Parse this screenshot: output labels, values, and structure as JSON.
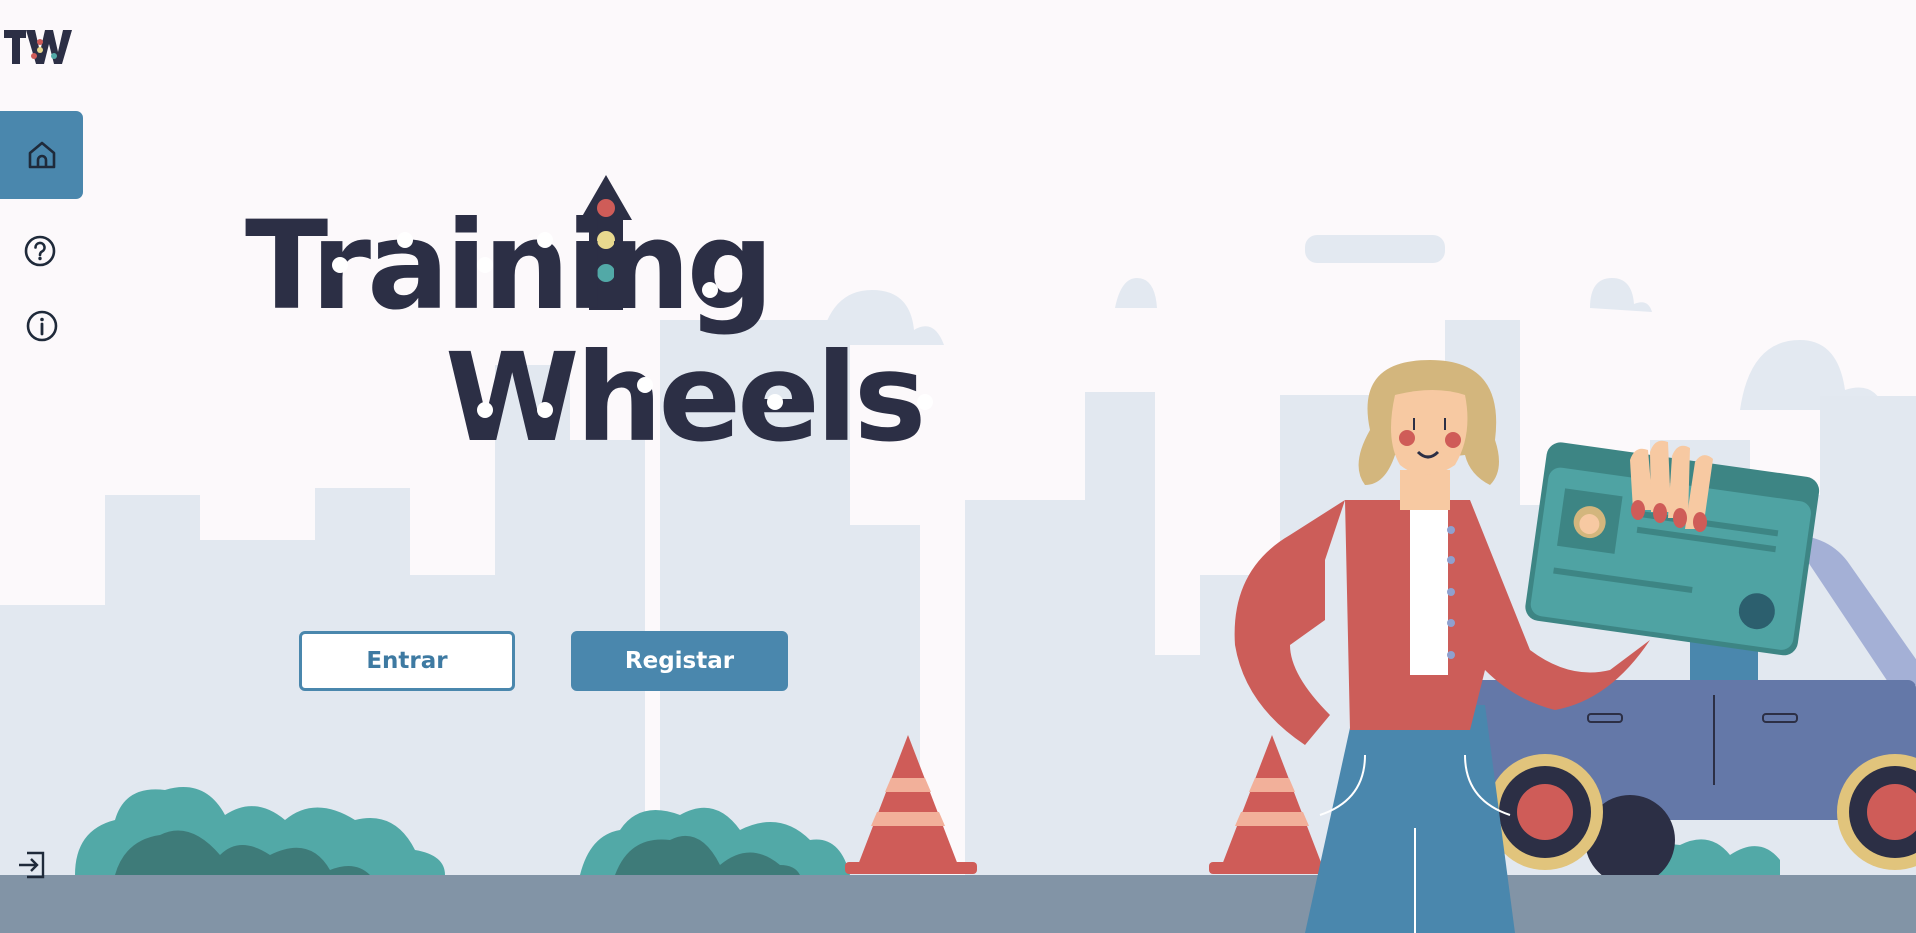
{
  "app": {
    "name": "Training Wheels",
    "logo_text": "TW"
  },
  "hero": {
    "title_line1": "Training",
    "title_line2": "Wheels"
  },
  "actions": {
    "login_label": "Entrar",
    "register_label": "Registar"
  },
  "sidebar": {
    "items": [
      {
        "icon": "home-icon",
        "active": true
      },
      {
        "icon": "help-icon",
        "active": false
      },
      {
        "icon": "info-icon",
        "active": false
      }
    ],
    "footer_icon": "login-icon"
  },
  "colors": {
    "accent": "#4a87ad",
    "title": "#2c2f45",
    "background": "#fcf9fb",
    "buildings": "#e2e8f0",
    "road": "#8294a6",
    "cone": "#cf5c58",
    "bush": "#52a9a7",
    "car": "#6478a8",
    "jacket": "#cc5d59",
    "card": "#4fa3a3"
  }
}
